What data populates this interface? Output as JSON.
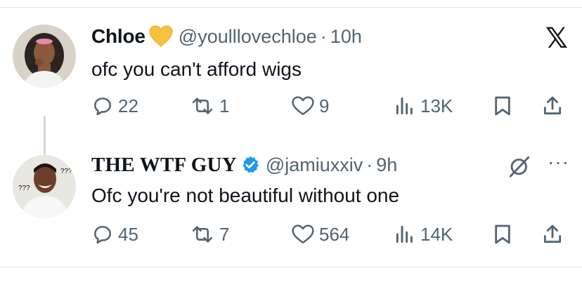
{
  "tweets": [
    {
      "name": "Chloe",
      "handle": "@youlllovechloe",
      "separator": "·",
      "time": "10h",
      "text": "ofc you can't afford wigs",
      "replies": "22",
      "reposts": "1",
      "likes": "9",
      "views": "13K",
      "badge": "yellow-heart-icon",
      "badge_color": "#f5c33b",
      "corner": "x-logo-icon",
      "corner_label": "𝕏"
    },
    {
      "name": "THE WTF GUY",
      "handle": "@jamiuxxiv",
      "separator": "·",
      "time": "9h",
      "text": "Ofc you're not beautiful without one",
      "replies": "45",
      "reposts": "7",
      "likes": "564",
      "views": "14K",
      "badge": "verified-badge-icon",
      "badge_color": "#1d9bf0",
      "more_label": "···"
    }
  ],
  "colors": {
    "text": "#0f1419",
    "secondary": "#536471",
    "divider": "#e1e6ea",
    "thread_line": "#cfd9de"
  }
}
